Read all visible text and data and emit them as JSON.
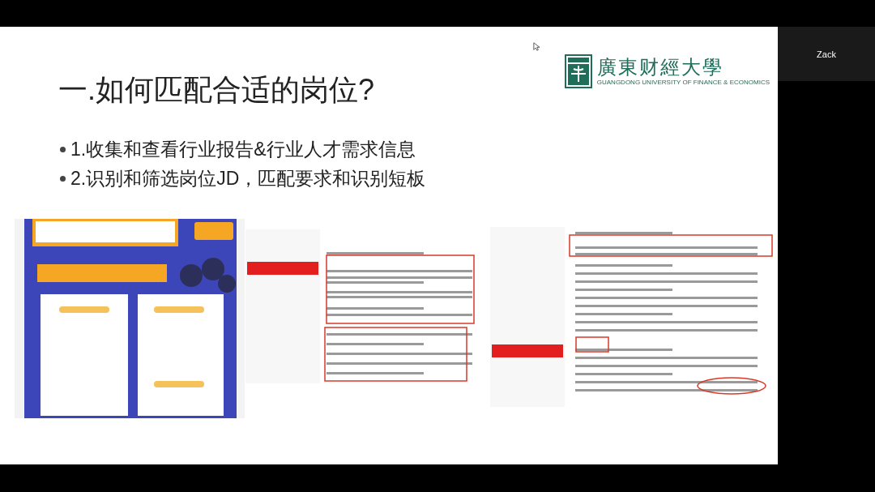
{
  "slide": {
    "logo": {
      "name_cn": "廣東财經大學",
      "name_en": "GUANGDONG UNIVERSITY OF FINANCE & ECONOMICS"
    },
    "title": "一.如何匹配合适的岗位?",
    "bullets": [
      "1.收集和查看行业报告&行业人才需求信息",
      "2.识别和筛选岗位JD，匹配要求和识别短板"
    ]
  },
  "participant": {
    "name": "Zack"
  }
}
